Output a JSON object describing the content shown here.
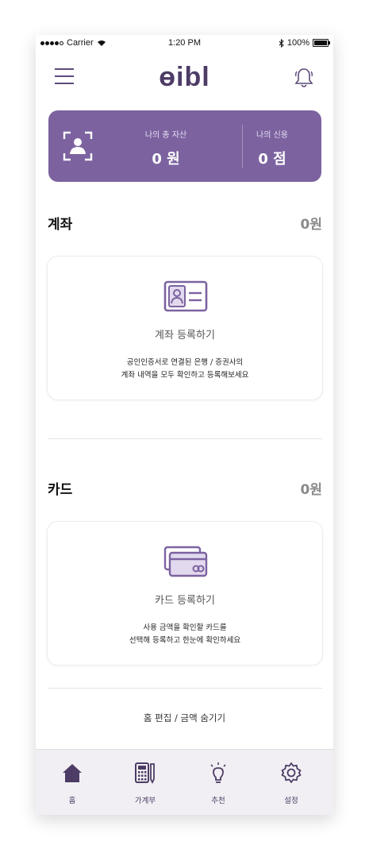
{
  "status_bar": {
    "carrier": "Carrier",
    "time": "1:20 PM",
    "battery": "100%"
  },
  "header": {
    "logo": "ɵibl",
    "menu_icon": "hamburger-menu-icon",
    "bell_icon": "bell-icon"
  },
  "summary": {
    "total_assets_label": "나의 총 자산",
    "total_assets_value": "0 원",
    "credit_label": "나의 신용",
    "credit_value": "0 점"
  },
  "accounts": {
    "title": "계좌",
    "amount": "0원",
    "register_title": "계좌 등록하기",
    "desc_line1": "공인인증서로 연결된 은행 / 증권사의",
    "desc_line2": "계좌 내역을 모두 확인하고 등록해보세요"
  },
  "cards": {
    "title": "카드",
    "amount": "0원",
    "register_title": "카드 등록하기",
    "desc_line1": "사용 금액을 확인할 카드를",
    "desc_line2": "선택해 등록하고 한눈에 확인하세요"
  },
  "footer_link": "홈 편집 / 금액 숨기기",
  "tabs": [
    {
      "label": "홈",
      "icon": "home-icon"
    },
    {
      "label": "가계부",
      "icon": "calculator-icon"
    },
    {
      "label": "추천",
      "icon": "lightbulb-icon"
    },
    {
      "label": "설정",
      "icon": "gear-icon"
    }
  ],
  "colors": {
    "brand": "#7c63a0",
    "logo": "#4d3c66"
  }
}
